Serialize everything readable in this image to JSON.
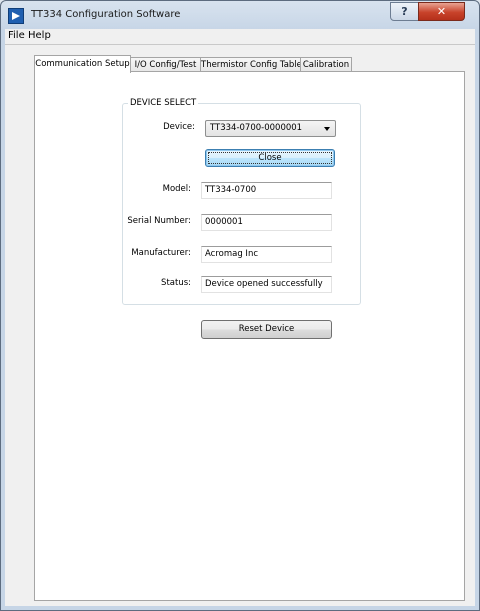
{
  "window": {
    "title": "TT334 Configuration Software",
    "help_glyph": "?",
    "close_glyph": "✕"
  },
  "menu": [
    {
      "label": "File"
    },
    {
      "label": "Help"
    }
  ],
  "tabs": [
    {
      "label": "Communication Setup"
    },
    {
      "label": "I/O Config/Test"
    },
    {
      "label": "Thermistor Config Table"
    },
    {
      "label": "Calibration"
    }
  ],
  "device_select": {
    "group_title": "DEVICE SELECT",
    "device_label": "Device:",
    "device_value": "TT334-0700-0000001",
    "close_button": "Close",
    "model_label": "Model:",
    "model_value": "TT334-0700",
    "serial_label": "Serial Number:",
    "serial_value": "0000001",
    "manufacturer_label": "Manufacturer:",
    "manufacturer_value": "Acromag Inc",
    "status_label": "Status:",
    "status_value": "Device opened successfully"
  },
  "reset_button": "Reset Device",
  "icons": {
    "app": "app-logo-icon",
    "dropdown": "chevron-down-icon"
  }
}
